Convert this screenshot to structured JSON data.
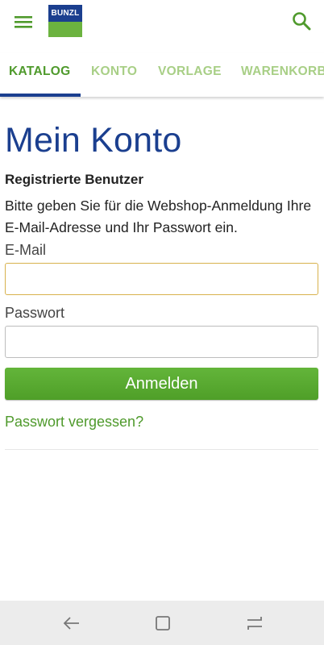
{
  "header": {
    "logo_text": "BUNZL",
    "menu_icon": "hamburger-menu-icon",
    "search_icon": "search-icon",
    "colors": {
      "brand_blue": "#1b3f8f",
      "brand_green": "#6cb33f",
      "accent_green": "#4f9a2c"
    }
  },
  "tabs": [
    {
      "label": "KATALOG",
      "active": true
    },
    {
      "label": "KONTO",
      "active": false
    },
    {
      "label": "VORLAGE",
      "active": false
    },
    {
      "label": "WARENKORB",
      "active": false
    }
  ],
  "main": {
    "title": "Mein Konto",
    "section_heading": "Registrierte Benutzer",
    "instructions": "Bitte geben Sie für die Webshop-Anmeldung Ihre E-Mail-Adresse und Ihr Passwort ein.",
    "email_label": "E-Mail",
    "email_value": "",
    "password_label": "Passwort",
    "password_value": "",
    "login_button": "Anmelden",
    "forgot_link": "Passwort vergessen?"
  },
  "system_nav": {
    "back_icon": "back-arrow-icon",
    "home_icon": "recent-apps-icon",
    "recents_icon": "overview-icon"
  }
}
